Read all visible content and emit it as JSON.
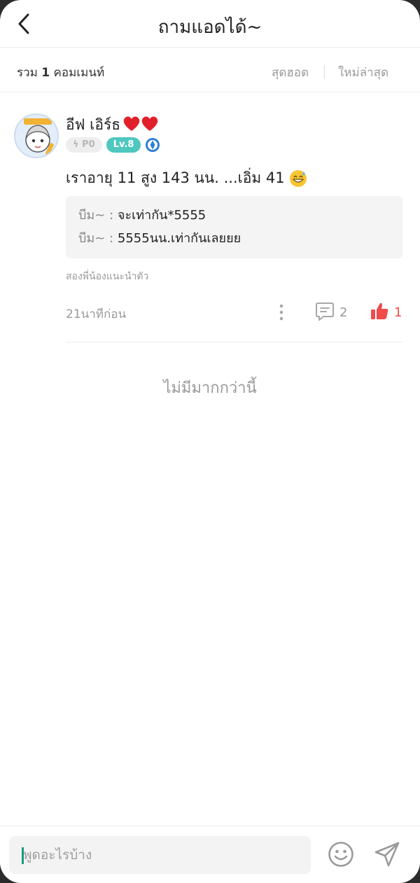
{
  "header": {
    "title": "ถามแอดได้~",
    "back_icon": "chevron-left-icon"
  },
  "sortbar": {
    "count_prefix": "รวม",
    "count_value": "1",
    "count_suffix": "คอมเมนท์",
    "sort_hot": "สุดฮอต",
    "sort_new": "ใหม่ล่าสุด"
  },
  "comment": {
    "username": "อีฟ เอิร์ธ",
    "username_decor": "two-red-hearts",
    "badge_points": "P0",
    "badge_level": "Lv.8",
    "text": "เราอายุ 11 สูง 143 นน. ...เอิ่ม 41",
    "text_emoji": "grinning-sweat-emoji",
    "replies": [
      {
        "name": "บีม~ :",
        "text": "จะเท่ากัน*5555"
      },
      {
        "name": "บีม~ :",
        "text": "5555นน.เท่ากันเลยยย"
      }
    ],
    "signature": "สองพี่น้องแนะนำตัว",
    "time": "21นาทีก่อน",
    "reply_count": "2",
    "like_count": "1"
  },
  "no_more": "ไม่มีมากกว่านี้",
  "bottombar": {
    "placeholder": "พูดอะไรบ้าง",
    "emoji_icon": "smiley-icon",
    "send_icon": "send-icon"
  },
  "colors": {
    "accent_teal": "#4ec7bf",
    "like_red": "#f04a4a",
    "muted_text": "#9a9a9a"
  }
}
